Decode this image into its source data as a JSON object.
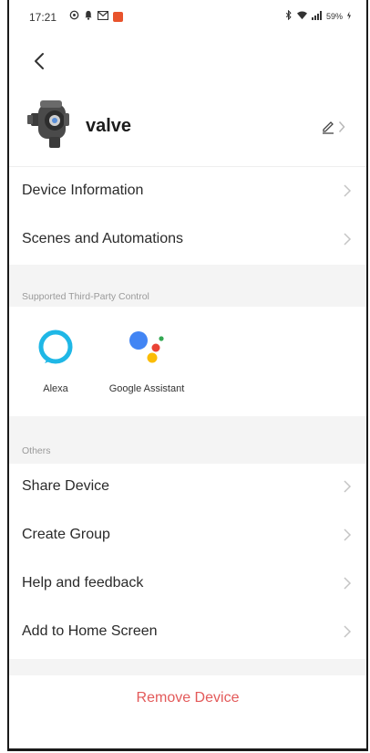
{
  "status_bar": {
    "time": "17:21",
    "battery_text": "59%"
  },
  "device": {
    "name": "valve"
  },
  "menu_top": [
    {
      "label": "Device Information"
    },
    {
      "label": "Scenes and Automations"
    }
  ],
  "third_party": {
    "section_title": "Supported Third-Party Control",
    "items": [
      {
        "label": "Alexa"
      },
      {
        "label": "Google Assistant"
      }
    ]
  },
  "others": {
    "section_title": "Others",
    "items": [
      {
        "label": "Share Device"
      },
      {
        "label": "Create Group"
      },
      {
        "label": "Help and feedback"
      },
      {
        "label": "Add to Home Screen"
      }
    ]
  },
  "remove_label": "Remove Device",
  "colors": {
    "remove": "#e35a5a",
    "alexa": "#1fb7e6",
    "google_blue": "#4285f4",
    "google_red": "#ea4335",
    "google_yellow": "#fbbc05",
    "google_green": "#34a853"
  },
  "icons": [
    "whatsapp-icon",
    "notification-icon",
    "gmail-icon",
    "app-icon",
    "bluetooth-icon",
    "wifi-icon",
    "signal-icon",
    "battery-icon",
    "back-arrow-icon",
    "valve-device-icon",
    "edit-pencil-icon",
    "chevron-right-icon",
    "alexa-icon",
    "google-assistant-icon"
  ]
}
